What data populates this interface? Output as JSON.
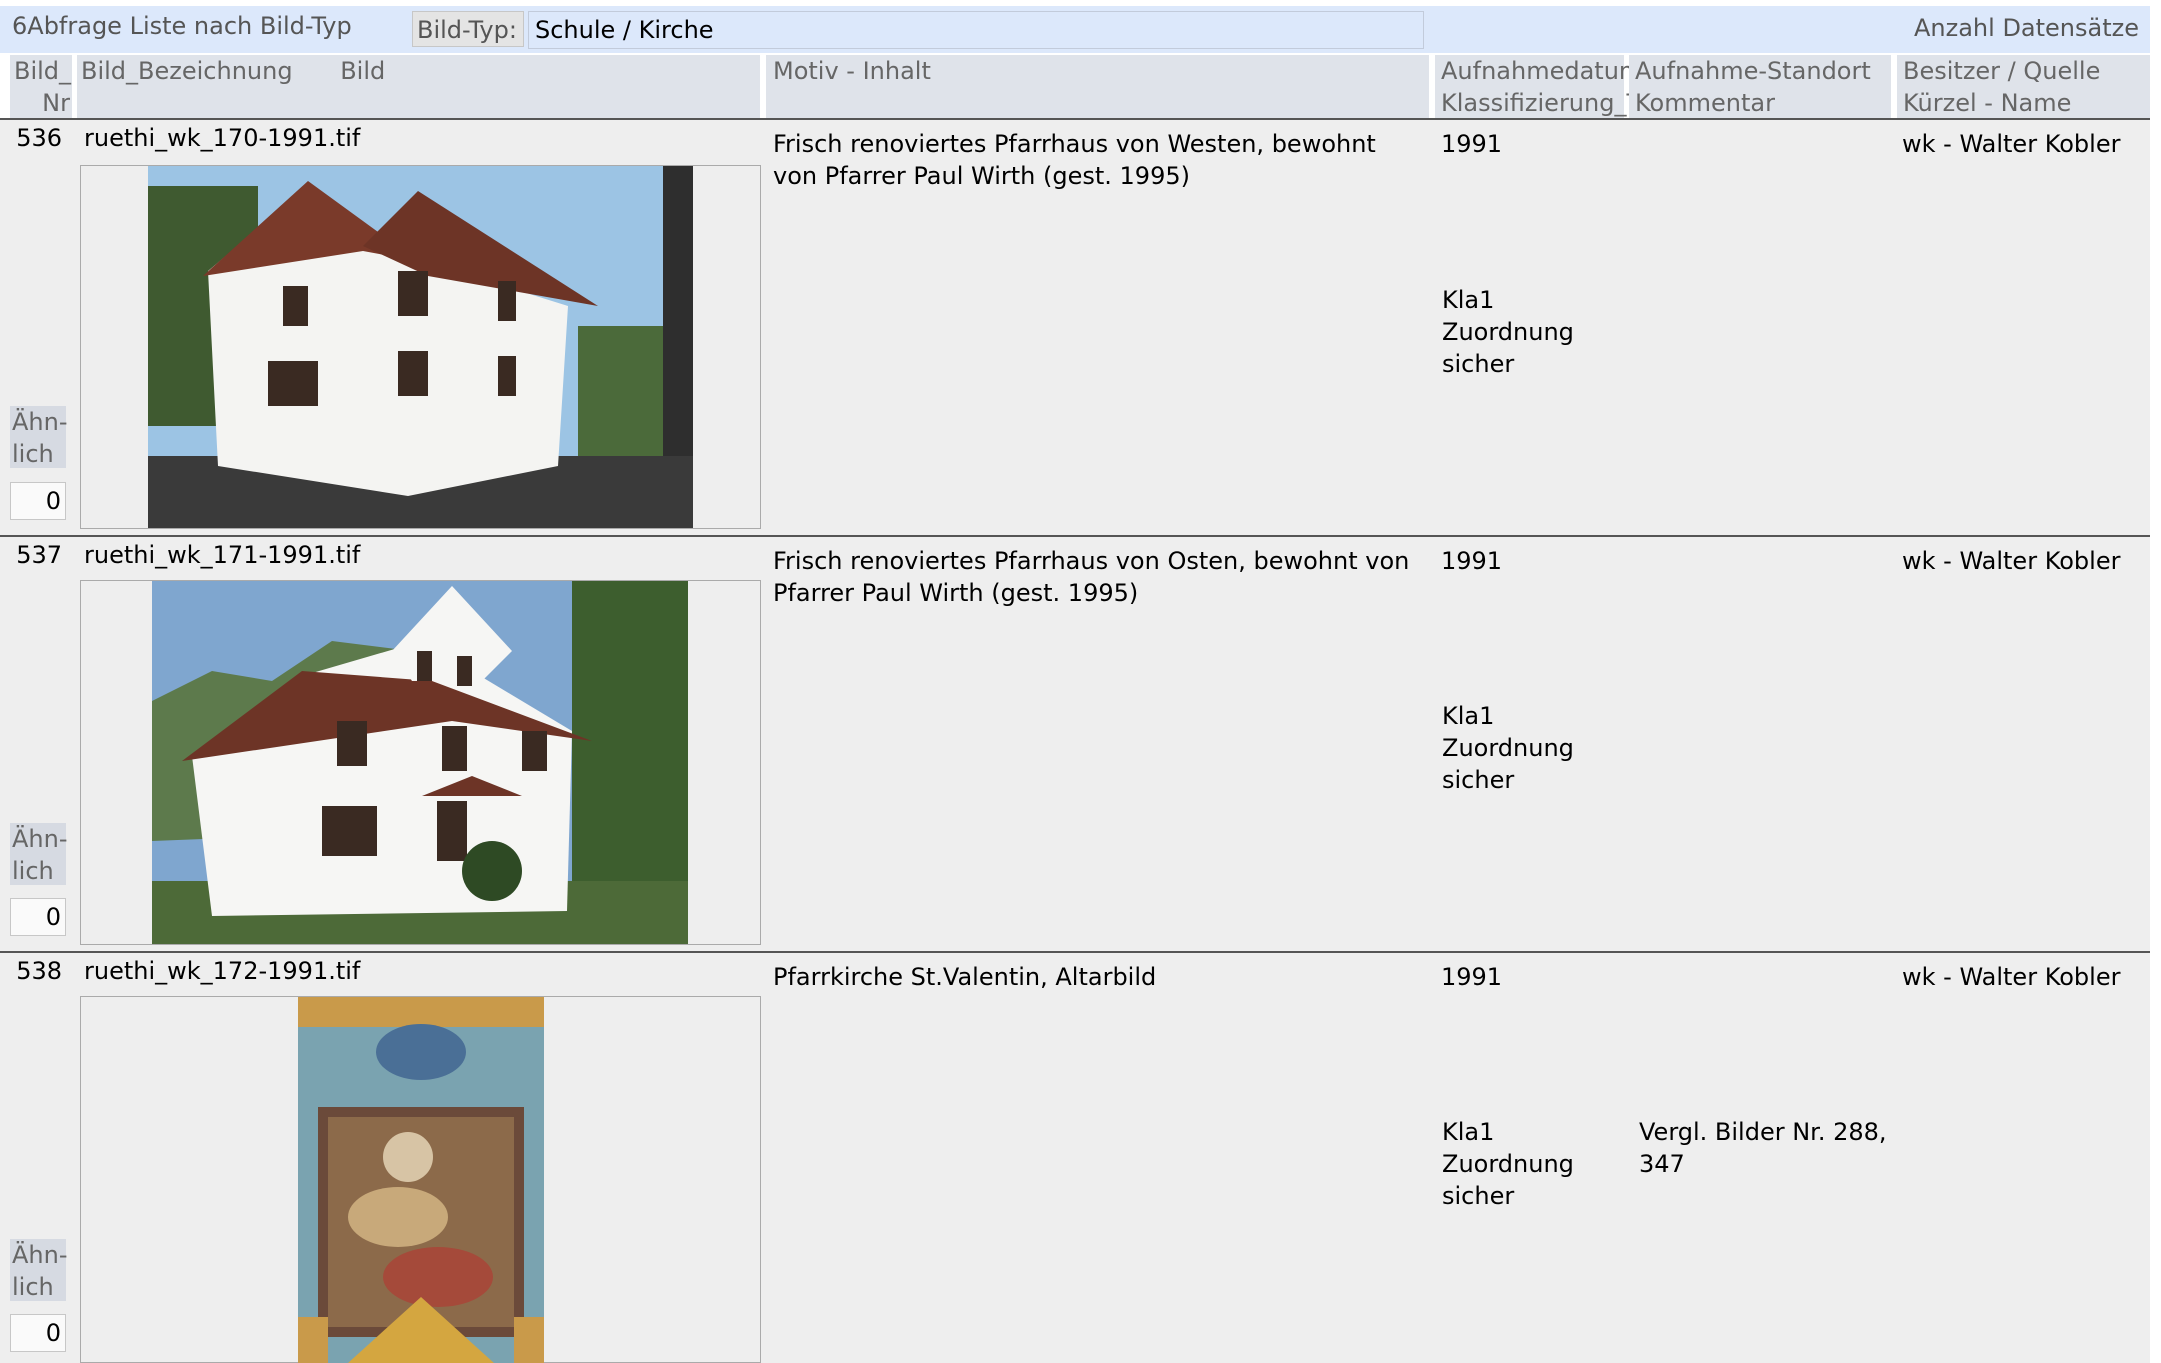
{
  "header": {
    "title": "6Abfrage Liste nach Bild-Typ",
    "filter_label": "Bild-Typ:",
    "filter_value": "Schule / Kirche",
    "count_label": "Anzahl Datensätze"
  },
  "columns": {
    "nr_line1": "Bild_",
    "nr_line2": "Nr",
    "bezeichnung": "Bild_Bezeichnung",
    "bild": "Bild",
    "motiv": "Motiv - Inhalt",
    "datum": "Aufnahmedatum",
    "klass": "Klassifizierung_T",
    "standort": "Aufnahme-Standort",
    "kommentar": "Kommentar",
    "besitzer": "Besitzer / Quelle",
    "kuerzel": "Kürzel - Name"
  },
  "records": [
    {
      "nr": "536",
      "bezeichnung": "ruethi_wk_170-1991.tif",
      "motiv": "Frisch renoviertes Pfarrhaus von Westen, bewohnt von Pfarrer Paul Wirth (gest. 1995)",
      "datum": "1991",
      "klass": "Kla1 Zuordnung sicher",
      "kommentar": "",
      "besitzer": "wk - Walter Kobler",
      "aehnlich_label": "Ähn-lich",
      "aehnlich_value": "0"
    },
    {
      "nr": "537",
      "bezeichnung": "ruethi_wk_171-1991.tif",
      "motiv": "Frisch renoviertes Pfarrhaus von Osten, bewohnt von Pfarrer Paul Wirth (gest. 1995)",
      "datum": "1991",
      "klass": "Kla1 Zuordnung sicher",
      "kommentar": "",
      "besitzer": "wk - Walter Kobler",
      "aehnlich_label": "Ähn-lich",
      "aehnlich_value": "0"
    },
    {
      "nr": "538",
      "bezeichnung": "ruethi_wk_172-1991.tif",
      "motiv": "Pfarrkirche St.Valentin, Altarbild",
      "datum": "1991",
      "klass": "Kla1 Zuordnung sicher",
      "kommentar": "Vergl. Bilder Nr. 288, 347",
      "besitzer": "wk - Walter Kobler",
      "aehnlich_label": "Ähn-lich",
      "aehnlich_value": "0"
    }
  ]
}
